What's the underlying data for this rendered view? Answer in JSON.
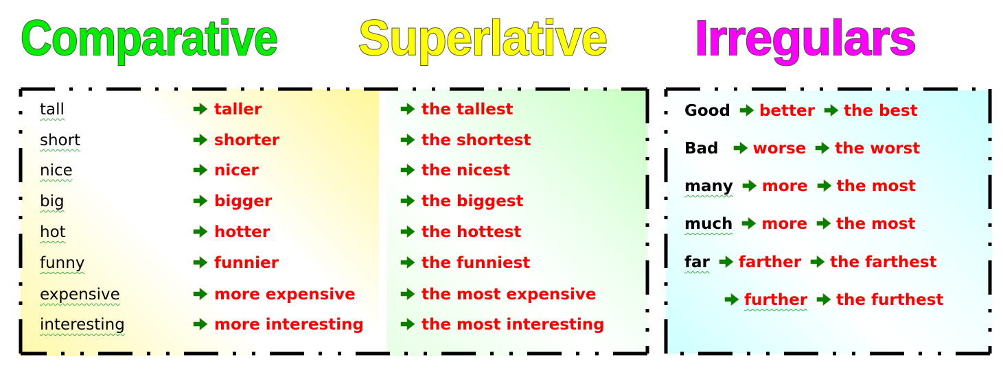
{
  "titles": {
    "comparative": "Comparative",
    "superlative": "Superlative",
    "irregulars": "Irregulars"
  },
  "colors": {
    "comparative_title": "#00ee00",
    "superlative_title": "#ffff00",
    "irregulars_title": "#ff00ff",
    "base_word": "#000000",
    "derived_word": "#ff0000",
    "arrow": "#008000"
  },
  "regular": [
    {
      "base": "tall",
      "comparative": "taller",
      "superlative": "the tallest"
    },
    {
      "base": "short",
      "comparative": "shorter",
      "superlative": "the shortest"
    },
    {
      "base": "nice",
      "comparative": "nicer",
      "superlative": "the nicest"
    },
    {
      "base": "big",
      "comparative": "bigger",
      "superlative": "the biggest"
    },
    {
      "base": "hot",
      "comparative": "hotter",
      "superlative": "the hottest"
    },
    {
      "base": "funny",
      "comparative": "funnier",
      "superlative": "the funniest"
    },
    {
      "base": "expensive",
      "comparative": "more expensive",
      "superlative": "the most expensive"
    },
    {
      "base": "interesting",
      "comparative": "more interesting",
      "superlative": "the most interesting"
    }
  ],
  "irregular": [
    {
      "base": "Good",
      "comparative": "better",
      "superlative": "the best"
    },
    {
      "base": "Bad",
      "comparative": "worse",
      "superlative": "the worst"
    },
    {
      "base": "many",
      "comparative": "more",
      "superlative": "the most"
    },
    {
      "base": "much",
      "comparative": "more",
      "superlative": "the most"
    },
    {
      "base": "far",
      "comparative": "farther",
      "superlative": "the farthest"
    },
    {
      "base": "",
      "comparative": "further",
      "superlative": "the furthest"
    }
  ],
  "icons": {
    "arrow": "right-arrow-icon"
  }
}
